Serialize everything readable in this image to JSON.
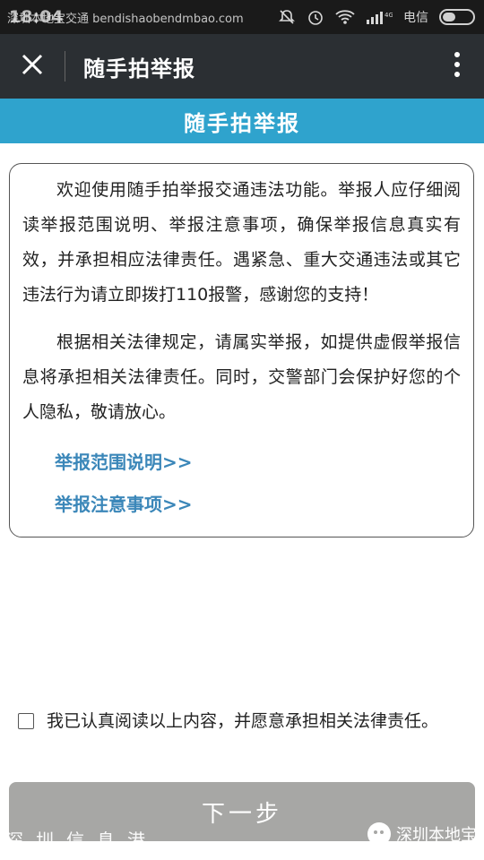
{
  "status_bar": {
    "time": "18:04",
    "overlay_text": "深圳本地宝交通 bendishaobendmbao.com",
    "network": "4G",
    "carrier": "电信"
  },
  "header": {
    "title": "随手拍举报"
  },
  "banner": {
    "title": "随手拍举报"
  },
  "content": {
    "paragraph1": "欢迎使用随手拍举报交通违法功能。举报人应仔细阅读举报范围说明、举报注意事项，确保举报信息真实有效，并承担相应法律责任。遇紧急、重大交通违法或其它违法行为请立即拨打110报警，感谢您的支持！",
    "paragraph2": "根据相关法律规定，请属实举报，如提供虚假举报信息将承担相关法律责任。同时，交警部门会保护好您的个人隐私，敬请放心。",
    "link_scope": "举报范围说明>>",
    "link_notes": "举报注意事项>>"
  },
  "agreement": {
    "text": "我已认真阅读以上内容，并愿意承担相关法律责任。",
    "checked": false
  },
  "next_button": {
    "label": "下一步"
  },
  "watermark": {
    "left": "深圳信息港",
    "right": "深圳本地宝"
  },
  "colors": {
    "banner": "#2fa3cd",
    "header": "#2b2f33",
    "link": "#3b87b9",
    "button": "#a7a7a5"
  }
}
